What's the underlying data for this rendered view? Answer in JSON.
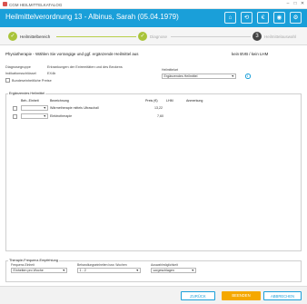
{
  "app": {
    "window_title": "CGM HEILMITTELKATALOG",
    "min": "–",
    "max": "□",
    "close": "✕"
  },
  "header": {
    "title": "Heilmittelverordnung 13 - Albinus, Sarah (05.04.1979)",
    "icons": [
      "home-icon",
      "history-icon",
      "euro-icon",
      "location-icon",
      "settings-icon"
    ]
  },
  "steps": [
    {
      "label": "Heilmittelbereich",
      "state": "done",
      "marker": "✓"
    },
    {
      "label": "Diagnose",
      "state": "done",
      "marker": "✓"
    },
    {
      "label": "Heilmittelauswahl",
      "state": "active",
      "marker": "3"
    }
  ],
  "main": {
    "heading": "Physiotherapie - Wählen Sie vorrangige und ggf. ergänzende Heilmittel aus",
    "bvb_status": "kein BVB / kein LHM",
    "diagnosegruppe_label": "Diagnosegruppe",
    "diagnosegruppe_value": "Erkrankungen der Extremitäten und des Beckens",
    "indikation_label": "Indikationsschlüssel",
    "indikation_value": "EX4b",
    "bundesweit_label": "Bundeseinheitliche Preise",
    "heilmittelart_label": "Heilmittelart",
    "heilmittelart_value": "Ergänzendes Heilmittel"
  },
  "table": {
    "legend": "Ergänzendes Heilmittel",
    "columns": [
      "Beh.-Einheit",
      "Bezeichnung",
      "Preis (€)",
      "LHM",
      "Anmerkung"
    ],
    "rows": [
      {
        "bezeichnung": "Wärmetherapie mittels Ultraschall",
        "preis": "13,22"
      },
      {
        "bezeichnung": "Elektrotherapie",
        "preis": "7,60"
      }
    ]
  },
  "therapie": {
    "legend": "Therapie-Frequenz-Empfehlung",
    "frequenz_label": "Frequenz-Einheit",
    "frequenz_value": "Einheiten pro Woche",
    "behandlung_label": "Behandlungseinheiten bzw. Wochen",
    "behandlung_value": "1 - 2",
    "auswahl_label": "Auswahlmöglichkeit",
    "auswahl_value": "vorgeschlagen"
  },
  "footer": {
    "back": "ZURÜCK",
    "save": "BEENDEN",
    "cancel": "ABBRECHEN"
  },
  "colors": {
    "brand": "#1a9fd9",
    "step_done": "#a9c439",
    "primary_button": "#f5a800"
  }
}
